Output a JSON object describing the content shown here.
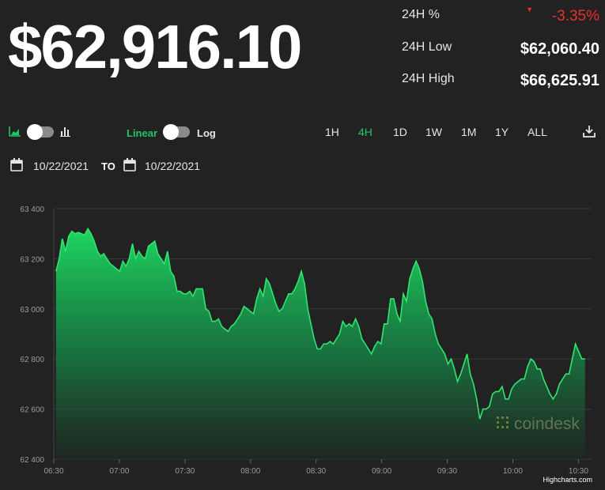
{
  "price": "$62,916.10",
  "stats": [
    {
      "label": "24H %",
      "value": "-3.35%",
      "direction": "down"
    },
    {
      "label": "24H Low",
      "value": "$62,060.40"
    },
    {
      "label": "24H High",
      "value": "$66,625.91"
    }
  ],
  "toolbar": {
    "scale_linear_label": "Linear",
    "scale_log_label": "Log",
    "ranges": [
      "1H",
      "4H",
      "1D",
      "1W",
      "1M",
      "1Y",
      "ALL"
    ],
    "active_range": "4H"
  },
  "date_range": {
    "from": "10/22/2021",
    "to_label": "TO",
    "to": "10/22/2021"
  },
  "credit": "Highcharts.com",
  "watermark": "coindesk",
  "colors": {
    "background": "#222222",
    "accent_green": "#21c46b",
    "negative_red": "#e8302b",
    "line": "#2ee66f"
  },
  "chart_data": {
    "type": "area",
    "xlabel": "",
    "ylabel": "",
    "ylim": [
      62400,
      63400
    ],
    "yticks": [
      "62 400",
      "62 600",
      "62 800",
      "63 000",
      "63 200",
      "63 400"
    ],
    "xticks": [
      {
        "label": "06:30",
        "t": 0
      },
      {
        "label": "07:00",
        "t": 30
      },
      {
        "label": "07:30",
        "t": 60
      },
      {
        "label": "08:00",
        "t": 90
      },
      {
        "label": "08:30",
        "t": 120
      },
      {
        "label": "09:00",
        "t": 150
      },
      {
        "label": "09:30",
        "t": 180
      },
      {
        "label": "10:00",
        "t": 210
      },
      {
        "label": "10:30",
        "t": 240
      }
    ],
    "x_minutes_from": "06:30",
    "grid": true,
    "series": [
      {
        "points": [
          [
            0,
            63150
          ],
          [
            1,
            63200
          ],
          [
            2,
            63280
          ],
          [
            3,
            63230
          ],
          [
            4,
            63290
          ],
          [
            5,
            63310
          ],
          [
            6,
            63300
          ],
          [
            7,
            63305
          ],
          [
            8,
            63300
          ],
          [
            9,
            63295
          ],
          [
            10,
            63320
          ],
          [
            11,
            63300
          ],
          [
            12,
            63270
          ],
          [
            13,
            63230
          ],
          [
            14,
            63210
          ],
          [
            15,
            63220
          ],
          [
            16,
            63200
          ],
          [
            17,
            63180
          ],
          [
            18,
            63170
          ],
          [
            19,
            63160
          ],
          [
            20,
            63150
          ],
          [
            21,
            63190
          ],
          [
            22,
            63170
          ],
          [
            23,
            63200
          ],
          [
            24,
            63260
          ],
          [
            25,
            63200
          ],
          [
            26,
            63230
          ],
          [
            27,
            63210
          ],
          [
            28,
            63200
          ],
          [
            29,
            63250
          ],
          [
            30,
            63260
          ],
          [
            31,
            63270
          ],
          [
            32,
            63220
          ],
          [
            33,
            63200
          ],
          [
            34,
            63180
          ],
          [
            35,
            63230
          ],
          [
            36,
            63150
          ],
          [
            37,
            63130
          ],
          [
            38,
            63070
          ],
          [
            39,
            63070
          ],
          [
            40,
            63060
          ],
          [
            41,
            63060
          ],
          [
            42,
            63070
          ],
          [
            43,
            63050
          ],
          [
            44,
            63080
          ],
          [
            45,
            63080
          ],
          [
            46,
            63080
          ],
          [
            47,
            63000
          ],
          [
            48,
            62990
          ],
          [
            49,
            62950
          ],
          [
            50,
            62950
          ],
          [
            51,
            62960
          ],
          [
            52,
            62930
          ],
          [
            53,
            62920
          ],
          [
            54,
            62910
          ],
          [
            55,
            62930
          ],
          [
            56,
            62940
          ],
          [
            57,
            62960
          ],
          [
            58,
            62980
          ],
          [
            59,
            63010
          ],
          [
            60,
            63000
          ],
          [
            61,
            62990
          ],
          [
            62,
            62980
          ],
          [
            63,
            63040
          ],
          [
            64,
            63080
          ],
          [
            65,
            63050
          ],
          [
            66,
            63120
          ],
          [
            67,
            63100
          ],
          [
            68,
            63060
          ],
          [
            69,
            63020
          ],
          [
            70,
            62990
          ],
          [
            71,
            63000
          ],
          [
            72,
            63030
          ],
          [
            73,
            63060
          ],
          [
            74,
            63060
          ],
          [
            75,
            63080
          ],
          [
            76,
            63110
          ],
          [
            77,
            63150
          ],
          [
            78,
            63100
          ],
          [
            79,
            63000
          ],
          [
            80,
            62940
          ],
          [
            81,
            62880
          ],
          [
            82,
            62840
          ],
          [
            83,
            62840
          ],
          [
            84,
            62860
          ],
          [
            85,
            62860
          ],
          [
            86,
            62870
          ],
          [
            87,
            62860
          ],
          [
            88,
            62880
          ],
          [
            89,
            62900
          ],
          [
            90,
            62950
          ],
          [
            91,
            62930
          ],
          [
            92,
            62940
          ],
          [
            93,
            62930
          ],
          [
            94,
            62960
          ],
          [
            95,
            62930
          ],
          [
            96,
            62880
          ],
          [
            97,
            62860
          ],
          [
            98,
            62840
          ],
          [
            99,
            62820
          ],
          [
            100,
            62850
          ],
          [
            101,
            62870
          ],
          [
            102,
            62860
          ],
          [
            103,
            62940
          ],
          [
            104,
            62940
          ],
          [
            105,
            63040
          ],
          [
            106,
            63040
          ],
          [
            107,
            62980
          ],
          [
            108,
            62950
          ],
          [
            109,
            63060
          ],
          [
            110,
            63030
          ],
          [
            111,
            63120
          ],
          [
            112,
            63160
          ],
          [
            113,
            63190
          ],
          [
            114,
            63160
          ],
          [
            115,
            63110
          ],
          [
            116,
            63030
          ],
          [
            117,
            62980
          ],
          [
            118,
            62960
          ],
          [
            119,
            62900
          ],
          [
            120,
            62860
          ],
          [
            121,
            62840
          ],
          [
            122,
            62820
          ],
          [
            123,
            62780
          ],
          [
            124,
            62800
          ],
          [
            125,
            62760
          ],
          [
            126,
            62710
          ],
          [
            127,
            62740
          ],
          [
            128,
            62780
          ],
          [
            129,
            62820
          ],
          [
            130,
            62740
          ],
          [
            131,
            62700
          ],
          [
            132,
            62640
          ],
          [
            133,
            62560
          ],
          [
            134,
            62600
          ],
          [
            135,
            62600
          ],
          [
            136,
            62610
          ],
          [
            137,
            62660
          ],
          [
            138,
            62670
          ],
          [
            139,
            62670
          ],
          [
            140,
            62690
          ],
          [
            141,
            62640
          ],
          [
            142,
            62640
          ],
          [
            143,
            62680
          ],
          [
            144,
            62700
          ],
          [
            145,
            62710
          ],
          [
            146,
            62720
          ],
          [
            147,
            62720
          ],
          [
            148,
            62770
          ],
          [
            149,
            62800
          ],
          [
            150,
            62790
          ],
          [
            151,
            62760
          ],
          [
            152,
            62760
          ],
          [
            153,
            62720
          ],
          [
            154,
            62690
          ],
          [
            155,
            62660
          ],
          [
            156,
            62640
          ],
          [
            157,
            62660
          ],
          [
            158,
            62700
          ],
          [
            159,
            62720
          ],
          [
            160,
            62740
          ],
          [
            161,
            62740
          ],
          [
            162,
            62800
          ],
          [
            163,
            62860
          ],
          [
            164,
            62830
          ],
          [
            165,
            62800
          ],
          [
            166,
            62800
          ]
        ]
      }
    ]
  }
}
